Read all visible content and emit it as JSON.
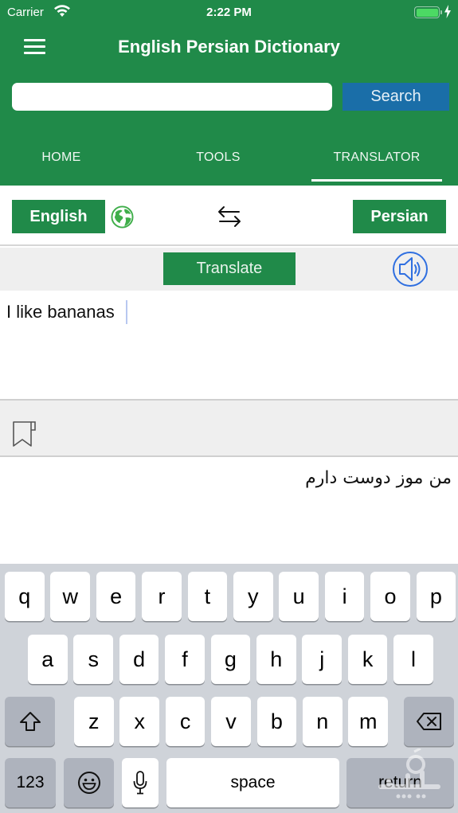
{
  "status_bar": {
    "carrier": "Carrier",
    "time": "2:22 PM",
    "battery_level": 1.0,
    "charging": true
  },
  "header": {
    "title": "English Persian Dictionary",
    "menu_icon": "hamburger-menu-icon"
  },
  "search": {
    "value": "",
    "placeholder": "",
    "button_label": "Search"
  },
  "tabs": [
    {
      "label": "HOME",
      "active": false
    },
    {
      "label": "TOOLS",
      "active": false
    },
    {
      "label": "TRANSLATOR",
      "active": true
    }
  ],
  "translator": {
    "source_language": "English",
    "target_language": "Persian",
    "globe_icon": "globe-icon",
    "swap_icon": "swap-arrows-icon",
    "translate_label": "Translate",
    "speaker_icon": "speaker-icon",
    "source_text": "I like bananas",
    "bookmark_icon": "bookmark-icon",
    "output_text": "من موز دوست دارم"
  },
  "keyboard": {
    "row1": [
      "q",
      "w",
      "e",
      "r",
      "t",
      "y",
      "u",
      "i",
      "o",
      "p"
    ],
    "row2": [
      "a",
      "s",
      "d",
      "f",
      "g",
      "h",
      "j",
      "k",
      "l"
    ],
    "row3": [
      "z",
      "x",
      "c",
      "v",
      "b",
      "n",
      "m"
    ],
    "numbers_label": "123",
    "space_label": "space",
    "return_label": "return",
    "shift_icon": "shift-icon",
    "delete_icon": "backspace-icon",
    "emoji_icon": "emoji-icon",
    "mic_icon": "microphone-icon"
  },
  "colors": {
    "brand_green": "#208a49",
    "search_blue": "#1a6ea8",
    "speaker_blue": "#2f6fe0",
    "keyboard_bg": "#cfd3d9"
  }
}
